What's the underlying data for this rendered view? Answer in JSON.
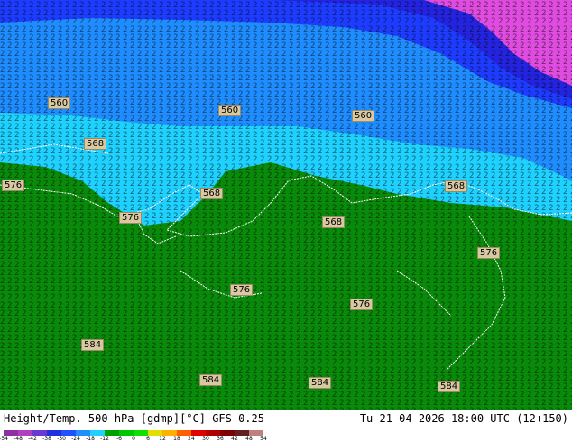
{
  "title": {
    "left": "Height/Temp. 500 hPa [gdmp][°C] GFS 0.25",
    "right": "Tu 21-04-2026 18:00 UTC (12+150)"
  },
  "contour_labels": [
    "560",
    "560",
    "560",
    "568",
    "576",
    "568",
    "576",
    "568",
    "568",
    "576",
    "576",
    "576",
    "584",
    "584",
    "584",
    "584"
  ],
  "colorbar": {
    "ticks": [
      "-54",
      "-48",
      "-42",
      "-38",
      "-30",
      "-24",
      "-18",
      "-12",
      "-6",
      "0",
      "6",
      "12",
      "18",
      "24",
      "30",
      "36",
      "42",
      "48",
      "54"
    ],
    "colors": [
      "#8f2fa0",
      "#b040c0",
      "#6a3ad0",
      "#2030e0",
      "#2050ff",
      "#2090ff",
      "#20d0ff",
      "#00a000",
      "#00c800",
      "#10e000",
      "#e0e000",
      "#ffb000",
      "#ff6000",
      "#e00000",
      "#b00000",
      "#800000",
      "#602020",
      "#c08080"
    ]
  },
  "map_colors": {
    "magenta": "#e04ce0",
    "blue_dark": "#2424e0",
    "blue": "#1e3cff",
    "light_blue": "#1f8dff",
    "cyan": "#1fd1ff",
    "green": "#0a8a0a",
    "green_light": "#14a014",
    "land_outline": "#ffffff"
  }
}
